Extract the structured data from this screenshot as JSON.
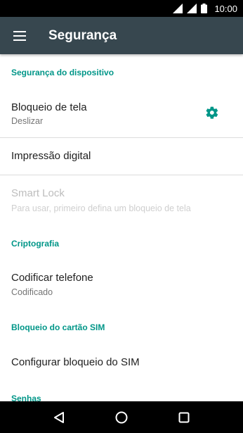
{
  "status_bar": {
    "time": "10:00"
  },
  "app_bar": {
    "title": "Segurança"
  },
  "sections": {
    "device_security": "Segurança do dispositivo",
    "encryption": "Criptografia",
    "sim_lock": "Bloqueio do cartão SIM",
    "passwords": "Senhas"
  },
  "prefs": {
    "screen_lock": {
      "title": "Bloqueio de tela",
      "summary": "Deslizar"
    },
    "fingerprint": {
      "title": "Impressão digital"
    },
    "smart_lock": {
      "title": "Smart Lock",
      "summary": "Para usar, primeiro defina um bloqueio de tela"
    },
    "encrypt_phone": {
      "title": "Codificar telefone",
      "summary": "Codificado"
    },
    "sim_lock_setup": {
      "title": "Configurar bloqueio do SIM"
    }
  },
  "colors": {
    "accent": "#009688",
    "app_bar": "#37474f",
    "status_bar": "#000000",
    "nav_bar": "#000000"
  },
  "icons": {
    "menu": "menu-icon",
    "settings": "gear-icon",
    "back": "back-icon",
    "home": "home-icon",
    "recents": "recents-icon"
  }
}
